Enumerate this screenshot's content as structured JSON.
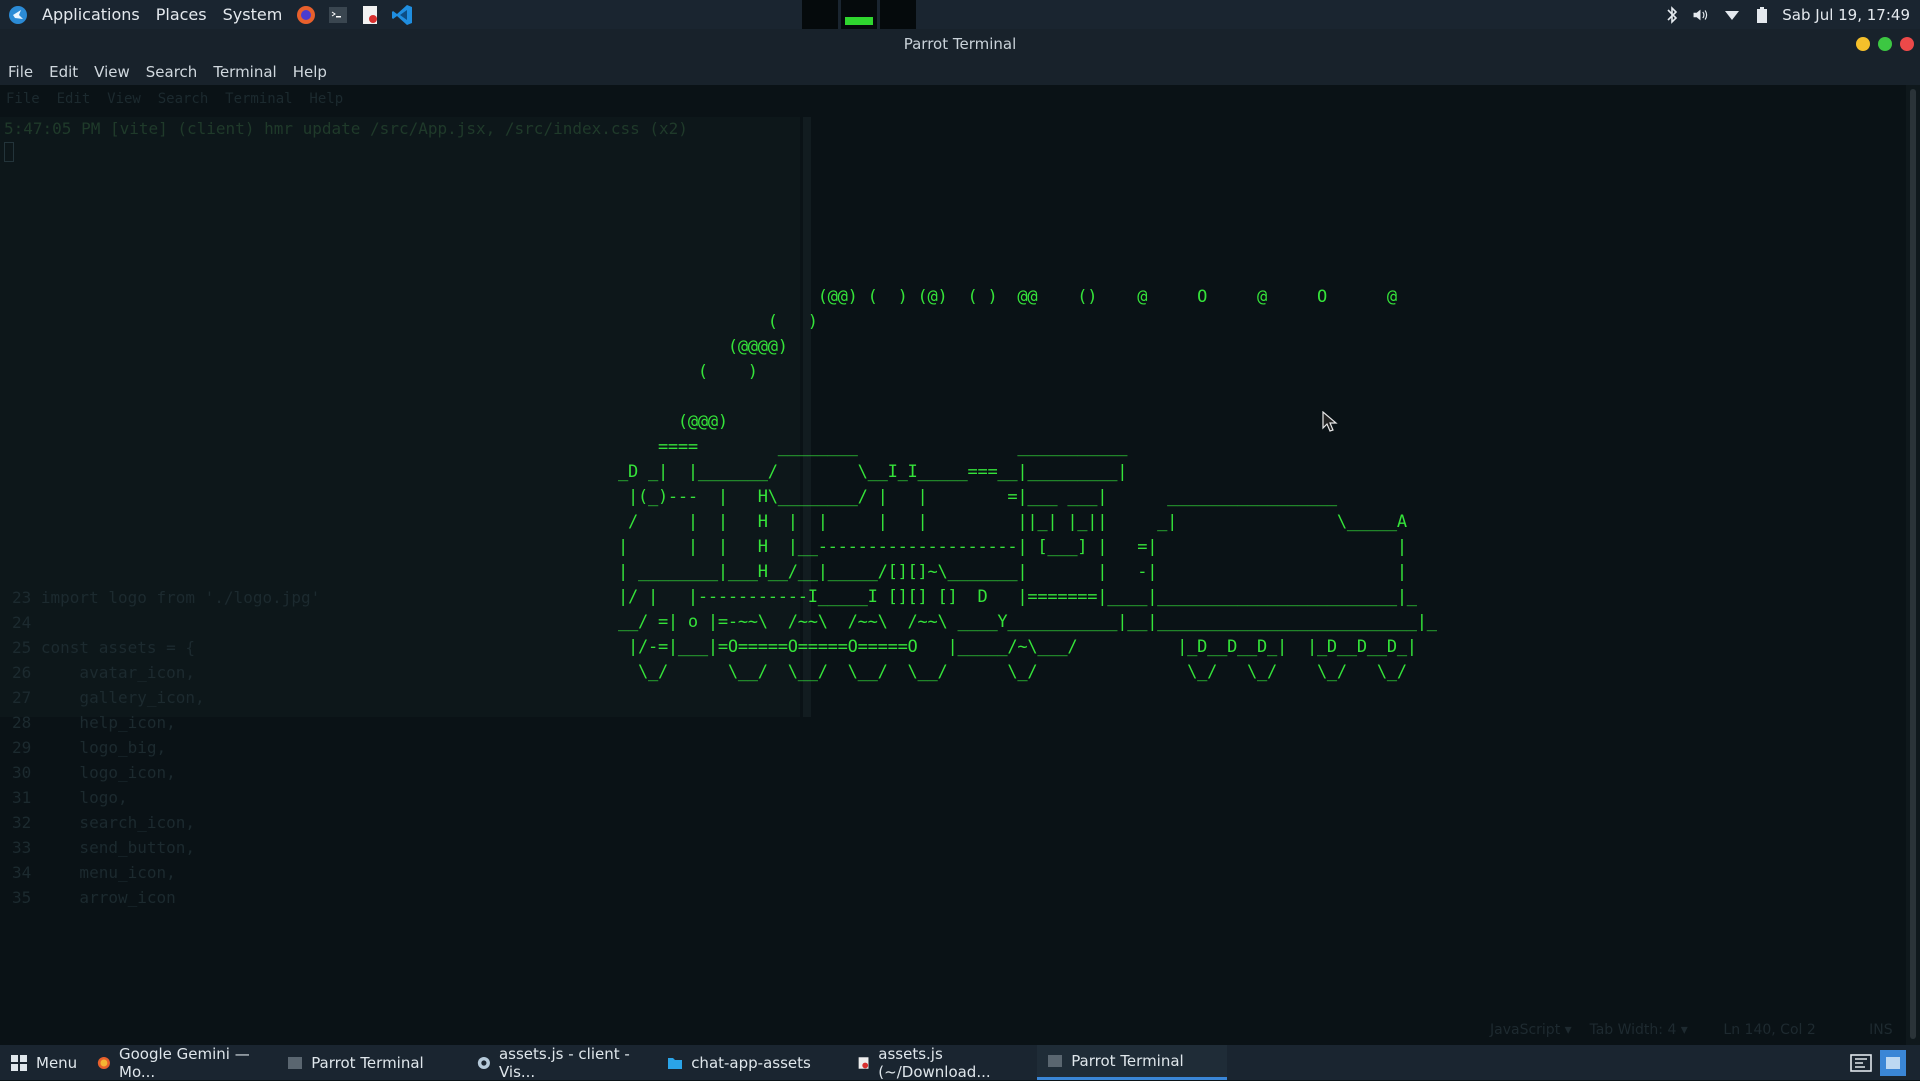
{
  "top_panel": {
    "menus": [
      "Applications",
      "Places",
      "System"
    ],
    "launchers": [
      "firefox-icon",
      "terminal-icon",
      "pdf-icon",
      "vscode-icon"
    ],
    "clock": "Sab Jul 19, 17:49"
  },
  "window": {
    "title": "Parrot Terminal",
    "menu": [
      "File",
      "Edit",
      "View",
      "Search",
      "Terminal",
      "Help"
    ]
  },
  "terminal": {
    "ghost_lines": [
      "File  Edit  View  Search  Terminal  Help",
      "5:47:05 PM [vite] (client) hmr update /src/App.jsx, /src/index.css (x2)"
    ],
    "ghost_code": [
      "23 import logo from './logo.jpg'",
      "24",
      "25 const assets = {",
      "26     avatar_icon,",
      "27     gallery_icon,",
      "28     help_icon,",
      "29     logo_big,",
      "30     logo_icon,",
      "31     logo,",
      "32     search_icon,",
      "33     send_button,",
      "34     menu_icon,",
      "35     arrow_icon"
    ],
    "ghost_status": "JavaScript ▾    Tab Width: 4 ▾        Ln 140, Col 2            INS",
    "train_art": [
      "                    (@@) (  ) (@)  ( )  @@    ()    @     O     @     O      @",
      "               (   )",
      "           (@@@@)",
      "        (    )",
      "",
      "      (@@@)",
      "    ====        ________                ___________",
      "_D _|  |_______/        \\__I_I_____===__|_________|",
      " |(_)---  |   H\\________/ |   |        =|___ ___|      _________________",
      " /     |  |   H  |  |     |   |         ||_| |_||     _|                \\_____A",
      "|      |  |   H  |__--------------------| [___] |   =|                        |",
      "| ________|___H__/__|_____/[][]~\\_______|       |   -|                        |",
      "|/ |   |-----------I_____I [][] []  D   |=======|____|________________________|_",
      "__/ =| o |=-~~\\  /~~\\  /~~\\  /~~\\ ____Y___________|__|__________________________|_",
      " |/-=|___|=O=====O=====O=====O   |_____/~\\___/          |_D__D__D_|  |_D__D__D_|",
      "  \\_/      \\__/  \\__/  \\__/  \\__/      \\_/               \\_/   \\_/    \\_/   \\_/"
    ]
  },
  "taskbar": {
    "menu_label": "Menu",
    "tasks": [
      {
        "label": "Google Gemini — Mo...",
        "icon": "firefox-icon"
      },
      {
        "label": "Parrot Terminal",
        "icon": "terminal-icon"
      },
      {
        "label": "assets.js - client - Vis...",
        "icon": "vscode-icon"
      },
      {
        "label": "chat-app-assets",
        "icon": "folder-icon"
      },
      {
        "label": "assets.js (~/Download...",
        "icon": "pdf-icon"
      },
      {
        "label": "Parrot Terminal",
        "icon": "terminal-icon"
      }
    ]
  },
  "colors": {
    "terminal_green": "#35e33a",
    "panel_bg": "#1a2530",
    "accent": "#3a86d6"
  }
}
